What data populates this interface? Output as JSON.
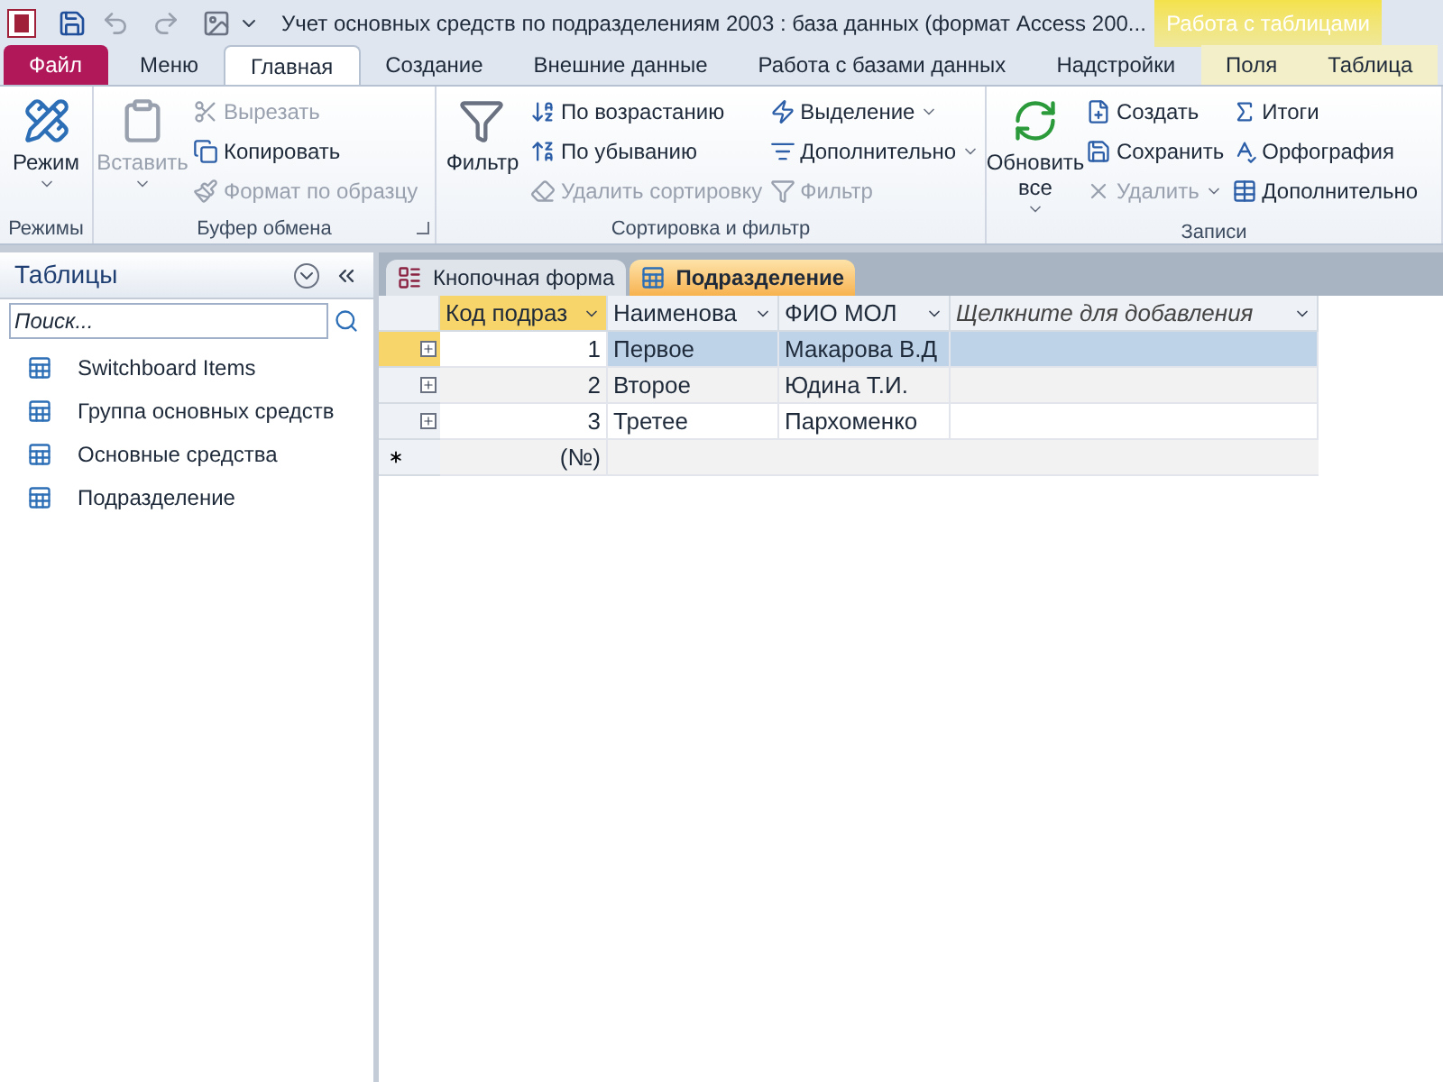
{
  "window": {
    "title": "Учет основных средств по подразделениям 2003 : база данных (формат Access 200...",
    "context_group": "Работа с таблицами"
  },
  "ribbon_tabs": [
    {
      "label": "Файл",
      "kind": "file",
      "selected": false
    },
    {
      "label": "Меню",
      "kind": "normal",
      "selected": false
    },
    {
      "label": "Главная",
      "kind": "normal",
      "selected": true
    },
    {
      "label": "Создание",
      "kind": "normal",
      "selected": false
    },
    {
      "label": "Внешние данные",
      "kind": "normal",
      "selected": false
    },
    {
      "label": "Работа с базами данных",
      "kind": "normal",
      "selected": false
    },
    {
      "label": "Надстройки",
      "kind": "normal",
      "selected": false
    },
    {
      "label": "Поля",
      "kind": "context",
      "selected": false
    },
    {
      "label": "Таблица",
      "kind": "context",
      "selected": false
    }
  ],
  "ribbon_groups": [
    {
      "label": "Режимы",
      "big": {
        "label": "Режим",
        "disabled": false,
        "dropdown": true
      }
    },
    {
      "label": "Буфер обмена",
      "launcher": true,
      "big": {
        "label": "Вставить",
        "disabled": true,
        "dropdown": true
      },
      "columns": [
        [
          {
            "label": "Вырезать",
            "disabled": true
          },
          {
            "label": "Копировать",
            "disabled": false
          },
          {
            "label": "Формат по образцу",
            "disabled": true
          }
        ]
      ]
    },
    {
      "label": "Сортировка и фильтр",
      "big": {
        "label": "Фильтр",
        "disabled": false
      },
      "columns": [
        [
          {
            "label": "По возрастанию",
            "disabled": false
          },
          {
            "label": "По убыванию",
            "disabled": false
          },
          {
            "label": "Удалить сортировку",
            "disabled": true
          }
        ],
        [
          {
            "label": "Выделение",
            "disabled": false,
            "dropdown": true
          },
          {
            "label": "Дополнительно",
            "disabled": false,
            "dropdown": true
          },
          {
            "label": "Фильтр",
            "disabled": true
          }
        ]
      ]
    },
    {
      "label": "Записи",
      "big": {
        "label": "Обновить все",
        "disabled": false,
        "dropdown": true
      },
      "columns": [
        [
          {
            "label": "Создать",
            "disabled": false
          },
          {
            "label": "Сохранить",
            "disabled": false
          },
          {
            "label": "Удалить",
            "disabled": true,
            "dropdown": true
          }
        ],
        [
          {
            "label": "Итоги",
            "disabled": false
          },
          {
            "label": "Орфография",
            "disabled": false
          },
          {
            "label": "Дополнительно",
            "disabled": false
          }
        ]
      ]
    }
  ],
  "nav_pane": {
    "title": "Таблицы",
    "search": {
      "placeholder": "Поиск..."
    },
    "items": [
      {
        "label": "Switchboard Items"
      },
      {
        "label": "Группа основных средств"
      },
      {
        "label": "Основные средства"
      },
      {
        "label": "Подразделение"
      }
    ]
  },
  "doc_tabs": [
    {
      "label": "Кнопочная форма",
      "selected": false
    },
    {
      "label": "Подразделение",
      "selected": true
    }
  ],
  "table": {
    "columns": [
      {
        "label": "Код подраз",
        "selected": true
      },
      {
        "label": "Наименова",
        "selected": false
      },
      {
        "label": "ФИО МОЛ",
        "selected": false
      },
      {
        "label": "Щелкните для добавления",
        "selected": false
      }
    ],
    "rows": [
      {
        "cells": [
          "1",
          "Первое",
          "Макарова В.Д",
          ""
        ],
        "selected": true
      },
      {
        "cells": [
          "2",
          "Второе",
          "Юдина Т.И.",
          ""
        ],
        "selected": false
      },
      {
        "cells": [
          "3",
          "Третее",
          "Пархоменко",
          ""
        ],
        "selected": false
      }
    ],
    "new_row": {
      "cell": "(№)"
    }
  }
}
